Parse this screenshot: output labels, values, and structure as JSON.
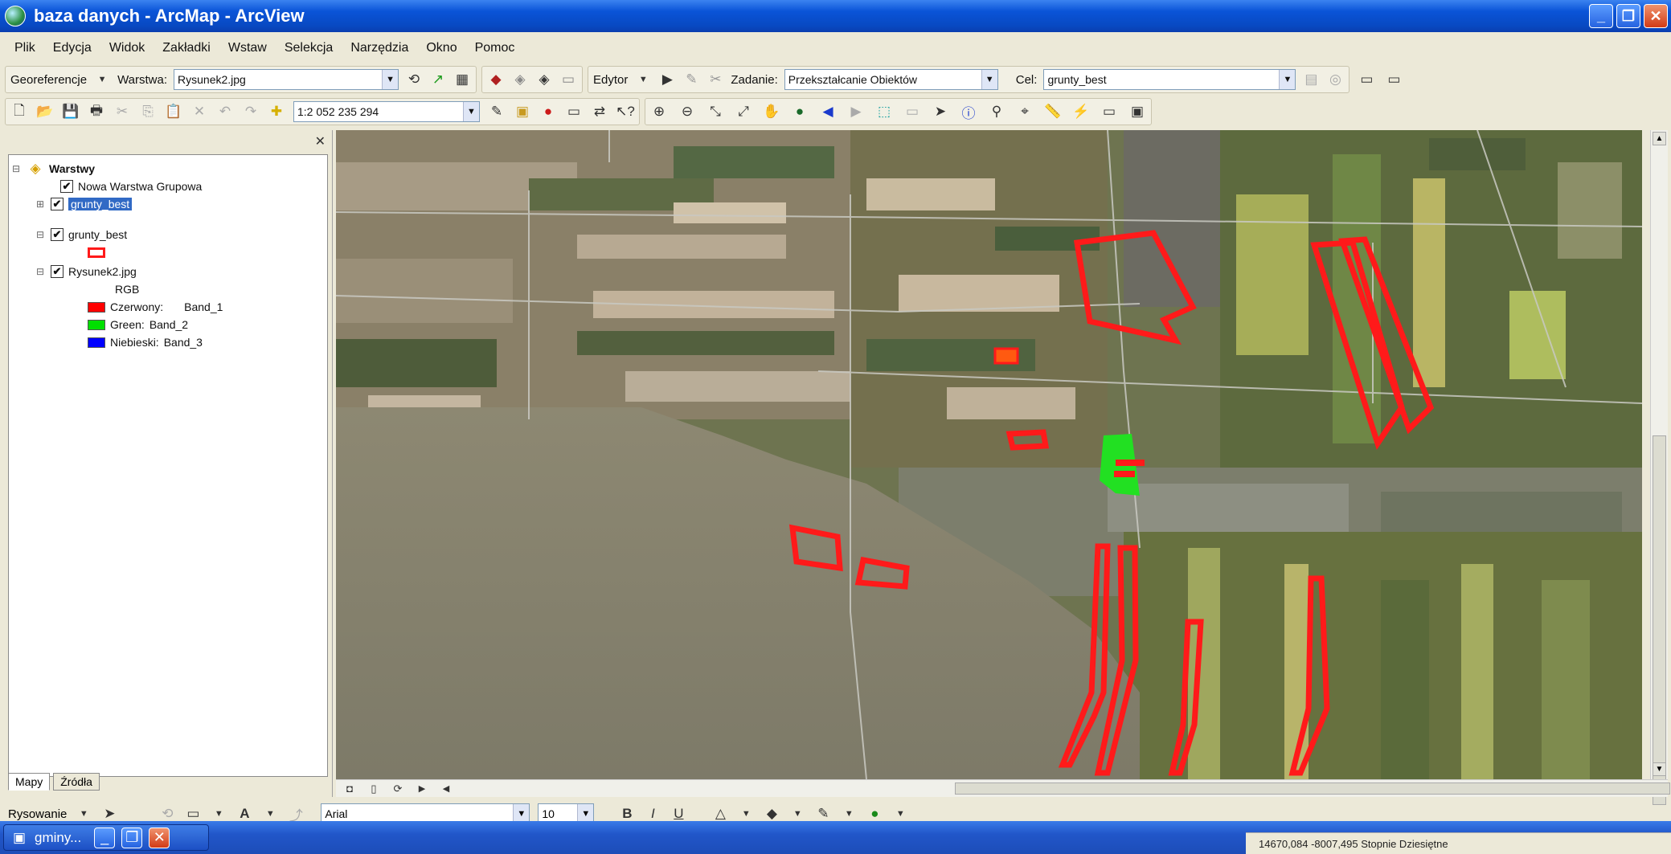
{
  "window": {
    "title": "baza danych - ArcMap - ArcView",
    "buttons": [
      "_",
      "❐",
      "✕"
    ]
  },
  "menu": [
    "Plik",
    "Edycja",
    "Widok",
    "Zakładki",
    "Wstaw",
    "Selekcja",
    "Narzędzia",
    "Okno",
    "Pomoc"
  ],
  "toolbar1": {
    "georef_label": "Georeferencje",
    "layer_label": "Warstwa:",
    "layer_value": "Rysunek2.jpg",
    "editor_label": "Edytor",
    "task_label": "Zadanie:",
    "task_value": "Przekształcanie Obiektów",
    "target_label": "Cel:",
    "target_value": "grunty_best"
  },
  "toolbar2": {
    "scale_value": "1:2 052 235 294"
  },
  "toc": {
    "root": "Warstwy",
    "layers": [
      {
        "name": "Nowa Warstwa Grupowa",
        "checked": "✔"
      },
      {
        "name": "grunty_best",
        "checked": "✔"
      },
      {
        "name": "grunty_best",
        "checked": "✔"
      },
      {
        "name": "Rysunek2.jpg",
        "checked": "✔"
      }
    ],
    "rgb_label": "RGB",
    "bands": [
      {
        "label": "Czerwony:",
        "band": "Band_1",
        "color": "#ff0000"
      },
      {
        "label": "Green:",
        "band": "Band_2",
        "color": "#00e000"
      },
      {
        "label": "Niebieski:",
        "band": "Band_3",
        "color": "#0000ff"
      }
    ],
    "tabs": [
      "Mapy",
      "Źródła"
    ]
  },
  "drawing": {
    "drawing_label": "Rysowanie",
    "font_value": "Arial",
    "size_value": "10",
    "bold": "B",
    "italic": "I",
    "underline": "U"
  },
  "taskbar": {
    "item_label": "gminy..."
  },
  "status": {
    "coords": "14670,084  -8007,495 Stopnie Dziesiętne"
  },
  "colors": {
    "selection_outline": "#ff1a1a",
    "highlight_fill": "#22e022"
  }
}
